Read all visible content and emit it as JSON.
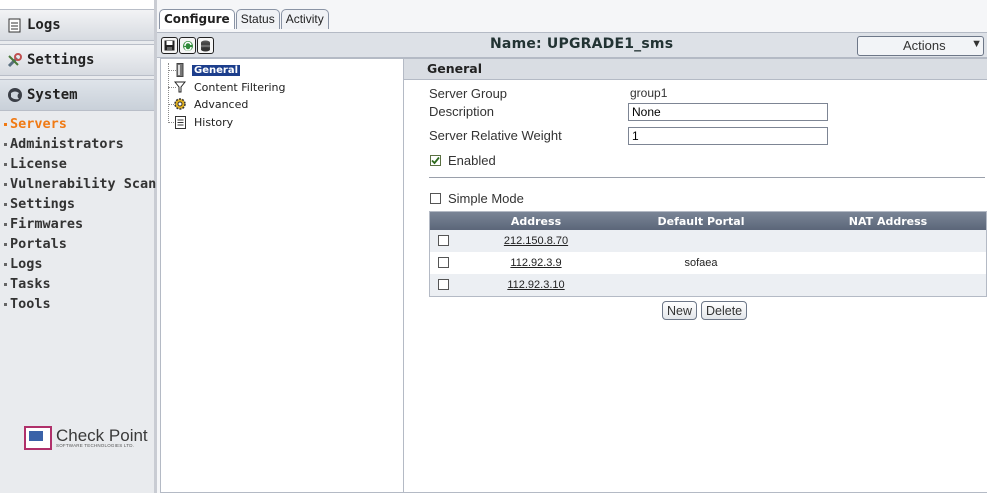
{
  "sidebar": {
    "sections": [
      {
        "label": "Logs",
        "icon": "log-document-icon"
      },
      {
        "label": "Settings",
        "icon": "settings-tools-icon"
      },
      {
        "label": "System",
        "icon": "system-globe-icon"
      }
    ],
    "nav": [
      "Servers",
      "Administrators",
      "License",
      "Vulnerability Scan",
      "Settings",
      "Firmwares",
      "Portals",
      "Logs",
      "Tasks",
      "Tools"
    ],
    "active_nav": "Servers",
    "logo": {
      "name": "Check Point",
      "tagline": "SOFTWARE TECHNOLOGIES LTD."
    }
  },
  "tabs": [
    {
      "label": "Configure",
      "active": true
    },
    {
      "label": "Status",
      "active": false
    },
    {
      "label": "Activity",
      "active": false
    }
  ],
  "toolbar": {
    "icons": [
      "save-icon",
      "refresh-icon",
      "database-icon"
    ],
    "name": "Name:  UPGRADE1_sms",
    "actions_label": "Actions"
  },
  "tree": [
    {
      "label": "General",
      "icon": "server-icon",
      "selected": true
    },
    {
      "label": "Content Filtering",
      "icon": "filter-funnel-icon",
      "selected": false
    },
    {
      "label": "Advanced",
      "icon": "gear-icon",
      "selected": false
    },
    {
      "label": "History",
      "icon": "history-document-icon",
      "selected": false
    }
  ],
  "panel": {
    "title": "General",
    "server_group_label": "Server Group",
    "server_group_value": "group1",
    "description_label": "Description",
    "description_value": "None",
    "weight_label": "Server Relative Weight",
    "weight_value": "1",
    "enabled_label": "Enabled",
    "enabled": true,
    "simple_mode_label": "Simple Mode",
    "simple_mode": false
  },
  "table": {
    "headers": [
      "Address",
      "Default Portal",
      "NAT Address"
    ],
    "rows": [
      {
        "address": "212.150.8.70",
        "portal": "",
        "nat": ""
      },
      {
        "address": "112.92.3.9",
        "portal": "sofaea",
        "nat": ""
      },
      {
        "address": "112.92.3.10",
        "portal": "",
        "nat": ""
      }
    ]
  },
  "buttons": {
    "new": "New",
    "delete": "Delete"
  }
}
